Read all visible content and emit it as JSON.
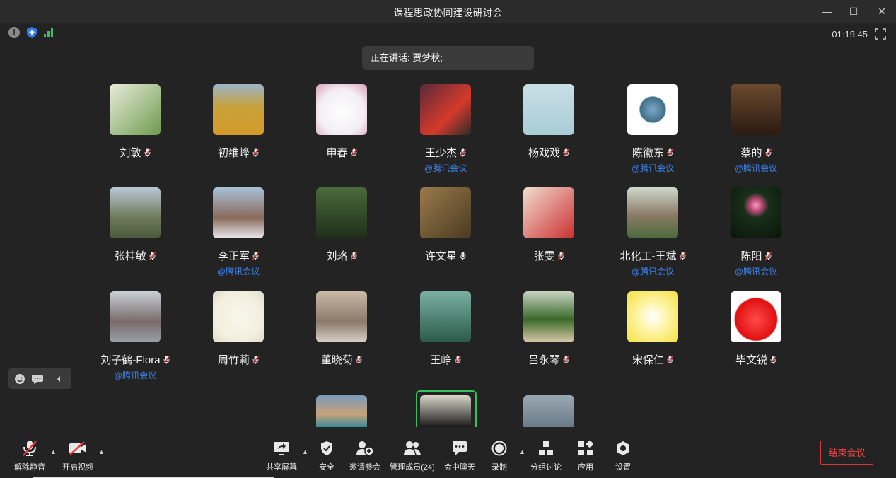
{
  "window": {
    "title": "课程思政协同建设研讨会"
  },
  "status": {
    "timer": "01:19:45",
    "info_glyph": "i"
  },
  "speaker": {
    "text": "正在讲话: 贾梦秋;"
  },
  "participants": [
    {
      "name": "刘敏",
      "tag": "",
      "mic": "muted",
      "bg": "linear-gradient(135deg,#e9ecda,#6e9b4f)"
    },
    {
      "name": "初维峰",
      "tag": "",
      "mic": "muted",
      "bg": "linear-gradient(180deg,#9bb4c9 0%,#c8a23a 45%,#d49a2a 100%)"
    },
    {
      "name": "申春",
      "tag": "",
      "mic": "muted",
      "bg": "radial-gradient(circle at 50% 55%,#ffffff 0%,#f2eef2 60%,#d9a0b4 100%)"
    },
    {
      "name": "王少杰",
      "tag": "@腾讯会议",
      "mic": "muted",
      "bg": "linear-gradient(135deg,#5a2a3a,#d63a2a 60%,#2a2a2a)"
    },
    {
      "name": "杨戏戏",
      "tag": "",
      "mic": "muted",
      "bg": "linear-gradient(180deg,#c9dfe6,#a8cdd6)"
    },
    {
      "name": "陈徽东",
      "tag": "@腾讯会议",
      "mic": "muted",
      "bg": "radial-gradient(circle,#7fa9c7 0%,#3f6f8a 35%,#ffffff 38%)"
    },
    {
      "name": "蔡的",
      "tag": "@腾讯会议",
      "mic": "muted",
      "bg": "linear-gradient(180deg,#6b4a2e,#2a1a12)"
    },
    {
      "name": "张桂敏",
      "tag": "",
      "mic": "muted",
      "bg": "linear-gradient(180deg,#b9c7d3,#6d7a5a 60%,#4a5a3a)"
    },
    {
      "name": "李正军",
      "tag": "@腾讯会议",
      "mic": "muted",
      "bg": "linear-gradient(180deg,#a9c0d8,#8a6a5a 60%,#e8e8f0)"
    },
    {
      "name": "刘珞",
      "tag": "",
      "mic": "muted",
      "bg": "linear-gradient(180deg,#4a6a3a,#1f2f1a)"
    },
    {
      "name": "许文星",
      "tag": "",
      "mic": "on",
      "bg": "linear-gradient(135deg,#9a7a4a,#4a3a22)"
    },
    {
      "name": "张雯",
      "tag": "",
      "mic": "muted",
      "bg": "linear-gradient(135deg,#f2dcd0,#c93030)"
    },
    {
      "name": "北化工-王斌",
      "tag": "@腾讯会议",
      "mic": "muted",
      "bg": "linear-gradient(180deg,#cfd8cc,#8a7a66 55%,#4a6a3a)"
    },
    {
      "name": "陈阳",
      "tag": "@腾讯会议",
      "mic": "muted",
      "bg": "radial-gradient(circle at 50% 35%,#f0a0c0 0%,#c04a7a 14%,#18301a 30%,#0a140a 100%)"
    },
    {
      "name": "刘子鹤-Flora",
      "tag": "@腾讯会议",
      "mic": "muted",
      "bg": "linear-gradient(180deg,#c8cfd6,#7a6a6a 60%,#9aa0a6)"
    },
    {
      "name": "周竹莉",
      "tag": "",
      "mic": "muted",
      "bg": "radial-gradient(circle,#f8f6ec 0%,#f3efde 65%,#e0dccc 100%)"
    },
    {
      "name": "董晓菊",
      "tag": "",
      "mic": "muted",
      "bg": "linear-gradient(180deg,#c9b8a6,#8a7a6a 60%,#d8d0c8)"
    },
    {
      "name": "王峥",
      "tag": "",
      "mic": "muted",
      "bg": "linear-gradient(180deg,#7ab0a0,#2a5a4a)"
    },
    {
      "name": "吕永琴",
      "tag": "",
      "mic": "muted",
      "bg": "linear-gradient(180deg,#c8d2c0,#3a6a2a 55%,#d8c8a8)"
    },
    {
      "name": "宋保仁",
      "tag": "",
      "mic": "muted",
      "bg": "radial-gradient(circle,#ffffff 0%,#fdf3a0 45%,#f5e040 100%)"
    },
    {
      "name": "毕文锐",
      "tag": "",
      "mic": "muted",
      "bg": "radial-gradient(circle at 50% 55%,#ff4a4a 0%,#e01010 55%,#ffffff 58%)"
    }
  ],
  "partial_tiles": [
    {
      "name": "participant-partial-1",
      "bg": "linear-gradient(180deg,#7a9ab8,#c8a27a 60%,#3a8a9a)"
    },
    {
      "name": "participant-partial-2",
      "bg": "linear-gradient(180deg,#d8d4c8,#1a1a1a)"
    },
    {
      "name": "participant-partial-3",
      "bg": "linear-gradient(180deg,#9aa8b0,#6a7a8a)"
    }
  ],
  "toolbar": {
    "unmute": "解除静音",
    "start_video": "开启视频",
    "share_screen": "共享屏幕",
    "security": "安全",
    "invite": "邀请参会",
    "manage_members": "管理成员(24)",
    "chat": "会中聊天",
    "record": "录制",
    "breakout": "分组讨论",
    "apps": "应用",
    "settings": "设置",
    "end_meeting": "结束会议"
  },
  "colors": {
    "accent_blue": "#3d84ef",
    "end_red": "#f04448",
    "active_green": "#33c35a",
    "signal_green": "#3fbf5f"
  }
}
